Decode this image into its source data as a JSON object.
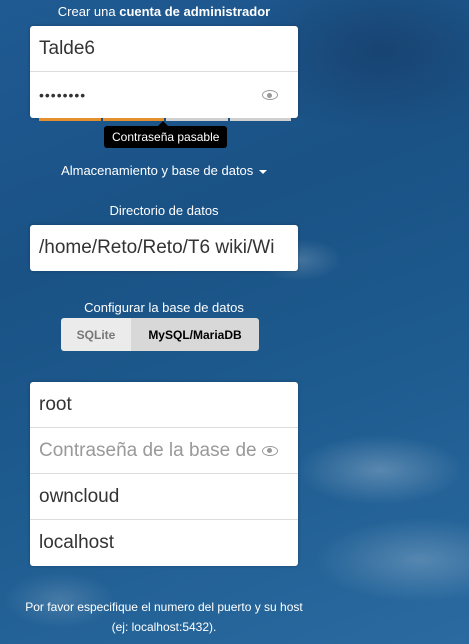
{
  "admin": {
    "title_prefix": "Crear una",
    "title_bold": "cuenta de administrador",
    "username": "Talde6",
    "password": "••••••••",
    "password_strength_tooltip": "Contraseña pasable"
  },
  "storage": {
    "toggle_label": "Almacenamiento y base de datos",
    "data_dir_label": "Directorio de datos",
    "data_dir_value": "/home/Reto/Reto/T6 wiki/Wi"
  },
  "database": {
    "config_label": "Configurar la base de datos",
    "options": [
      "SQLite",
      "MySQL/MariaDB"
    ],
    "selected": "MySQL/MariaDB",
    "user": "root",
    "password_placeholder": "Contraseña de la base de datos",
    "name": "owncloud",
    "host": "localhost",
    "hint": "Por favor especifique el numero del puerto y su host (ej: localhost:5432)."
  },
  "colors": {
    "strength": "#e4902f",
    "tooltip_bg": "#000000",
    "selected_option_bg": "#d8d8d8"
  },
  "icons": [
    "eye-icon",
    "caret-down-icon"
  ]
}
